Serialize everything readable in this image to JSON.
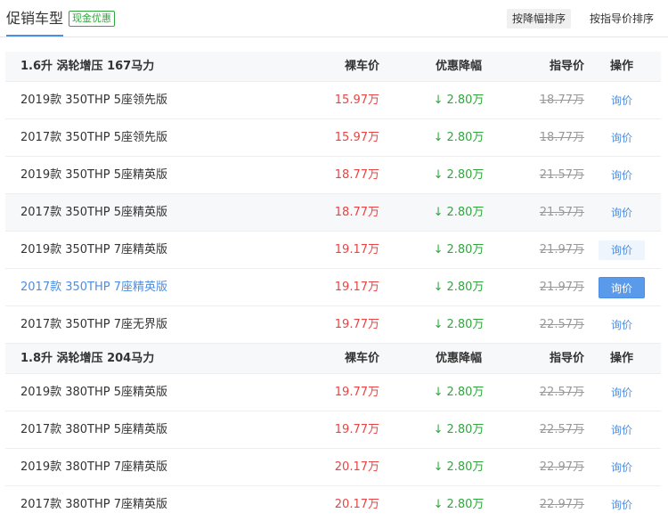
{
  "header": {
    "title": "促销车型",
    "badge": "现金优惠",
    "sort_by_discount": "按降幅排序",
    "sort_by_msrp": "按指导价排序"
  },
  "columns": {
    "price": "裸车价",
    "discount": "优惠降幅",
    "msrp": "指导价",
    "action": "操作"
  },
  "groups": [
    {
      "title": "1.6升 涡轮增压 167马力",
      "rows": [
        {
          "name": "2019款 350THP 5座领先版",
          "price": "15.97万",
          "discount": "2.80万",
          "msrp": "18.77万",
          "action": "询价"
        },
        {
          "name": "2017款 350THP 5座领先版",
          "price": "15.97万",
          "discount": "2.80万",
          "msrp": "18.77万",
          "action": "询价"
        },
        {
          "name": "2019款 350THP 5座精英版",
          "price": "18.77万",
          "discount": "2.80万",
          "msrp": "21.57万",
          "action": "询价"
        },
        {
          "name": "2017款 350THP 5座精英版",
          "price": "18.77万",
          "discount": "2.80万",
          "msrp": "21.57万",
          "action": "询价"
        },
        {
          "name": "2019款 350THP 7座精英版",
          "price": "19.17万",
          "discount": "2.80万",
          "msrp": "21.97万",
          "action": "询价"
        },
        {
          "name": "2017款 350THP 7座精英版",
          "price": "19.17万",
          "discount": "2.80万",
          "msrp": "21.97万",
          "action": "询价"
        },
        {
          "name": "2017款 350THP 7座无界版",
          "price": "19.77万",
          "discount": "2.80万",
          "msrp": "22.57万",
          "action": "询价"
        }
      ]
    },
    {
      "title": "1.8升 涡轮增压 204马力",
      "rows": [
        {
          "name": "2019款 380THP 5座精英版",
          "price": "19.77万",
          "discount": "2.80万",
          "msrp": "22.57万",
          "action": "询价"
        },
        {
          "name": "2017款 380THP 5座精英版",
          "price": "19.77万",
          "discount": "2.80万",
          "msrp": "22.57万",
          "action": "询价"
        },
        {
          "name": "2019款 380THP 7座精英版",
          "price": "20.17万",
          "discount": "2.80万",
          "msrp": "22.97万",
          "action": "询价"
        },
        {
          "name": "2017款 380THP 7座精英版",
          "price": "20.17万",
          "discount": "2.80万",
          "msrp": "22.97万",
          "action": "询价"
        }
      ]
    }
  ],
  "icons": {
    "discount_arrow": "down-arrow-icon"
  },
  "colors": {
    "accent": "#4a8ee6",
    "price": "#e64545",
    "discount": "#2fa83b",
    "msrp": "#999999"
  }
}
